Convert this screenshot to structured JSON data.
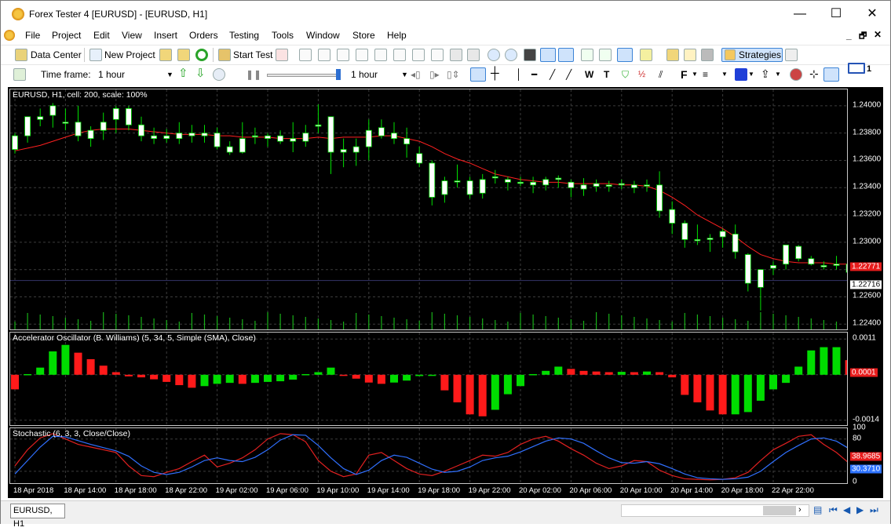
{
  "window": {
    "title": "Forex Tester 4  [EURUSD] - [EURUSD, H1]",
    "minimize": "—",
    "maximize": "☐",
    "close": "✕"
  },
  "menu": [
    "File",
    "Project",
    "Edit",
    "View",
    "Insert",
    "Orders",
    "Testing",
    "Tools",
    "Window",
    "Store",
    "Help"
  ],
  "mdi": {
    "min": "_",
    "restore": "🗗",
    "close": "✕"
  },
  "toolbar1": {
    "data_center": "Data Center",
    "new_project": "New Project",
    "start_test": "Start Test",
    "strategies": "Strategies"
  },
  "toolbar2": {
    "timeframe_label": "Time frame:",
    "timeframe_value": "1 hour",
    "speed_tf_value": "1 hour",
    "font_btn": "F",
    "mail_count": "1"
  },
  "chart": {
    "main_label": "EURUSD, H1, cell: 200, scale: 100%",
    "ac_label": "Accelerator Oscillator (B. Williams) (5, 34, 5, Simple (SMA), Close)",
    "stoch_label": "Stochastic (6, 3, 3, Close/Close)",
    "main_ticks": [
      "1.24000",
      "1.23800",
      "1.23600",
      "1.23400",
      "1.23200",
      "1.23000",
      "1.22600",
      "1.22400"
    ],
    "main_tags": {
      "ma": "1.22771",
      "price": "1.22716"
    },
    "ac_ticks": [
      "0.0011",
      "-0.0014"
    ],
    "ac_tag": "0.0001",
    "stoch_ticks": [
      "100",
      "80",
      "0"
    ],
    "stoch_tags": {
      "main": "38.9685",
      "signal": "30.3710"
    },
    "x_ticks": [
      "18 Apr 2018",
      "18 Apr 14:00",
      "18 Apr 18:00",
      "18 Apr 22:00",
      "19 Apr 02:00",
      "19 Apr 06:00",
      "19 Apr 10:00",
      "19 Apr 14:00",
      "19 Apr 18:00",
      "19 Apr 22:00",
      "20 Apr 02:00",
      "20 Apr 06:00",
      "20 Apr 10:00",
      "20 Apr 14:00",
      "20 Apr 18:00",
      "22 Apr 22:00"
    ]
  },
  "colors": {
    "bull": "#ffffff",
    "bear": "#ffffff",
    "wick": "#00e000",
    "ma": "#ff2020",
    "ac_up": "#00dd00",
    "ac_down": "#ff1a1a",
    "stoch_main": "#e02020",
    "stoch_signal": "#3070ff",
    "price_line": "#34346a",
    "grid": "#3c3c3c"
  },
  "chart_data": [
    {
      "type": "candlestick",
      "title": "EURUSD, H1, cell: 200, scale: 100%",
      "ylim": [
        1.2235,
        1.2412
      ],
      "candles": [
        [
          1.2368,
          1.238,
          1.2365,
          1.2378
        ],
        [
          1.2378,
          1.2392,
          1.2373,
          1.2392
        ],
        [
          1.239,
          1.2398,
          1.2385,
          1.2392
        ],
        [
          1.2393,
          1.2402,
          1.2384,
          1.24
        ],
        [
          1.2388,
          1.2398,
          1.2382,
          1.2388
        ],
        [
          1.2388,
          1.24,
          1.2374,
          1.2378
        ],
        [
          1.2376,
          1.2385,
          1.237,
          1.2382
        ],
        [
          1.2382,
          1.2395,
          1.2375,
          1.2388
        ],
        [
          1.239,
          1.24,
          1.238,
          1.2398
        ],
        [
          1.2398,
          1.24,
          1.2382,
          1.2386
        ],
        [
          1.2386,
          1.2392,
          1.2374,
          1.2378
        ],
        [
          1.2378,
          1.2384,
          1.2372,
          1.2376
        ],
        [
          1.2376,
          1.2383,
          1.2373,
          1.2378
        ],
        [
          1.238,
          1.2388,
          1.2372,
          1.2376
        ],
        [
          1.2378,
          1.2386,
          1.2373,
          1.238
        ],
        [
          1.238,
          1.2386,
          1.2373,
          1.2378
        ],
        [
          1.238,
          1.2384,
          1.2368,
          1.237
        ],
        [
          1.237,
          1.2374,
          1.2364,
          1.2366
        ],
        [
          1.2366,
          1.2388,
          1.2365,
          1.2376
        ],
        [
          1.2378,
          1.2384,
          1.2372,
          1.2378
        ],
        [
          1.2378,
          1.238,
          1.237,
          1.2376
        ],
        [
          1.2378,
          1.2382,
          1.2372,
          1.2374
        ],
        [
          1.2374,
          1.2388,
          1.2366,
          1.2376
        ],
        [
          1.2374,
          1.2386,
          1.237,
          1.238
        ],
        [
          1.2385,
          1.2401,
          1.238,
          1.2386
        ],
        [
          1.2392,
          1.2392,
          1.235,
          1.2366
        ],
        [
          1.2366,
          1.2376,
          1.2355,
          1.2368
        ],
        [
          1.2366,
          1.2376,
          1.2356,
          1.237
        ],
        [
          1.237,
          1.239,
          1.236,
          1.2382
        ],
        [
          1.2384,
          1.239,
          1.2376,
          1.2378
        ],
        [
          1.238,
          1.2388,
          1.2372,
          1.2376
        ],
        [
          1.2376,
          1.2384,
          1.2362,
          1.2372
        ],
        [
          1.2365,
          1.237,
          1.2355,
          1.2358
        ],
        [
          1.2358,
          1.236,
          1.2327,
          1.2333
        ],
        [
          1.2335,
          1.2348,
          1.2329,
          1.2345
        ],
        [
          1.2345,
          1.2357,
          1.234,
          1.2345
        ],
        [
          1.2335,
          1.2348,
          1.2332,
          1.2345
        ],
        [
          1.2346,
          1.235,
          1.2332,
          1.2336
        ],
        [
          1.2348,
          1.2353,
          1.2343,
          1.2348
        ],
        [
          1.2344,
          1.2348,
          1.2338,
          1.2346
        ],
        [
          1.2344,
          1.2348,
          1.2341,
          1.2344
        ],
        [
          1.2342,
          1.2348,
          1.2336,
          1.2344
        ],
        [
          1.2346,
          1.2348,
          1.2338,
          1.2342
        ],
        [
          1.2347,
          1.2349,
          1.234,
          1.2346
        ],
        [
          1.2344,
          1.2346,
          1.2333,
          1.234
        ],
        [
          1.2339,
          1.2347,
          1.2334,
          1.2342
        ],
        [
          1.2341,
          1.2346,
          1.2337,
          1.2343
        ],
        [
          1.2341,
          1.2345,
          1.2337,
          1.2342
        ],
        [
          1.2342,
          1.2346,
          1.2339,
          1.2343
        ],
        [
          1.2342,
          1.2345,
          1.2336,
          1.234
        ],
        [
          1.2342,
          1.2346,
          1.2337,
          1.2342
        ],
        [
          1.2342,
          1.2352,
          1.2318,
          1.2323
        ],
        [
          1.2324,
          1.233,
          1.2306,
          1.2314
        ],
        [
          1.2314,
          1.2316,
          1.2296,
          1.2302
        ],
        [
          1.2302,
          1.2313,
          1.2298,
          1.2302
        ],
        [
          1.2302,
          1.2306,
          1.2293,
          1.2303
        ],
        [
          1.2304,
          1.231,
          1.2296,
          1.2308
        ],
        [
          1.2306,
          1.2313,
          1.2288,
          1.2293
        ],
        [
          1.2291,
          1.2292,
          1.2264,
          1.227
        ],
        [
          1.2267,
          1.228,
          1.225,
          1.228
        ],
        [
          1.2281,
          1.2286,
          1.2276,
          1.2283
        ],
        [
          1.2284,
          1.2298,
          1.228,
          1.2298
        ],
        [
          1.2297,
          1.2298,
          1.2286,
          1.2288
        ],
        [
          1.2288,
          1.229,
          1.2283,
          1.2284
        ],
        [
          1.2283,
          1.2286,
          1.228,
          1.2282
        ],
        [
          1.2283,
          1.229,
          1.228,
          1.2284
        ],
        [
          1.2284,
          1.2288,
          1.2275,
          1.2278
        ],
        [
          1.227,
          1.2285,
          1.227,
          1.2284
        ],
        [
          1.2284,
          1.2288,
          1.2277,
          1.228
        ],
        [
          1.228,
          1.2282,
          1.2272,
          1.2274
        ],
        [
          1.2274,
          1.2278,
          1.2269,
          1.2272
        ],
        [
          1.2268,
          1.228,
          1.2266,
          1.2278
        ],
        [
          1.2277,
          1.228,
          1.227,
          1.2274
        ],
        [
          1.2276,
          1.2278,
          1.227,
          1.2272
        ]
      ],
      "ma": [
        1.2367,
        1.2369,
        1.2371,
        1.2374,
        1.2377,
        1.238,
        1.2382,
        1.2383,
        1.2383,
        1.2383,
        1.2382,
        1.2381,
        1.238,
        1.2379,
        1.2379,
        1.2379,
        1.2378,
        1.2378,
        1.2377,
        1.2377,
        1.2377,
        1.2376,
        1.2376,
        1.2376,
        1.2377,
        1.2376,
        1.2377,
        1.2377,
        1.2377,
        1.2378,
        1.2378,
        1.2376,
        1.2374,
        1.237,
        1.2365,
        1.2361,
        1.2358,
        1.2354,
        1.235,
        1.2348,
        1.2346,
        1.2345,
        1.2344,
        1.2344,
        1.2343,
        1.2343,
        1.2343,
        1.2343,
        1.2342,
        1.2342,
        1.2341,
        1.2338,
        1.2333,
        1.2327,
        1.232,
        1.2315,
        1.231,
        1.2304,
        1.2297,
        1.2291,
        1.2288,
        1.2286,
        1.2285,
        1.2285,
        1.2285,
        1.2284,
        1.2284,
        1.2284,
        1.2283,
        1.2282,
        1.2281,
        1.228,
        1.2279,
        1.2278
      ]
    },
    {
      "type": "bar",
      "title": "Accelerator Oscillator (B. Williams) (5, 34, 5, Simple (SMA), Close)",
      "ylim": [
        -0.0016,
        0.0013
      ],
      "values": [
        -0.00045,
        2e-05,
        0.00022,
        0.00072,
        0.00092,
        0.00068,
        0.00048,
        0.00028,
        8e-05,
        -5e-05,
        -8e-05,
        -0.00014,
        -0.00022,
        -0.00032,
        -0.0004,
        -0.00035,
        -0.00028,
        -0.00025,
        -0.00028,
        -0.00025,
        -0.00022,
        -0.0002,
        -0.00015,
        2e-05,
        8e-05,
        0.00022,
        -1e-05,
        -0.00012,
        -0.00024,
        -0.00028,
        -0.00024,
        -0.00018,
        -4e-05,
        -1e-05,
        -0.00048,
        -0.00085,
        -0.00122,
        -0.00128,
        -0.00108,
        -0.0006,
        -0.00035,
        2e-05,
        0.00012,
        0.00025,
        0.00018,
        0.00012,
        0.0001,
        8e-05,
        9e-05,
        8e-05,
        0.0001,
        8e-05,
        -8e-05,
        -0.00062,
        -0.00085,
        -0.0011,
        -0.00122,
        -0.00122,
        -0.00115,
        -0.0008,
        -0.00045,
        -0.00025,
        0.00025,
        0.00075,
        0.00085,
        0.00085,
        0.00045,
        0.00025,
        0.00022,
        0.00015,
        0.00012,
        0.00012,
        0.0001,
        4e-05
      ]
    },
    {
      "type": "line",
      "title": "Stochastic (6, 3, 3, Close/Close)",
      "ylim": [
        -5,
        100
      ],
      "series": [
        {
          "values": [
            30,
            60,
            82,
            90,
            80,
            70,
            65,
            60,
            55,
            30,
            12,
            10,
            18,
            25,
            38,
            50,
            28,
            35,
            45,
            60,
            80,
            90,
            88,
            75,
            40,
            20,
            10,
            15,
            50,
            55,
            40,
            25,
            15,
            12,
            20,
            30,
            40,
            50,
            48,
            55,
            70,
            80,
            85,
            76,
            62,
            50,
            35,
            25,
            30,
            40,
            38,
            22,
            12,
            6,
            5,
            4,
            5,
            8,
            18,
            40,
            60,
            72,
            85,
            88,
            70,
            55,
            35,
            20,
            10,
            8,
            12,
            28,
            35,
            39
          ]
        },
        {
          "values": [
            15,
            40,
            65,
            85,
            84,
            77,
            70,
            64,
            58,
            48,
            30,
            18,
            14,
            18,
            28,
            40,
            45,
            40,
            38,
            46,
            60,
            78,
            88,
            87,
            68,
            45,
            25,
            14,
            22,
            40,
            50,
            46,
            35,
            24,
            18,
            20,
            28,
            40,
            45,
            48,
            56,
            66,
            76,
            82,
            80,
            72,
            58,
            45,
            36,
            35,
            38,
            34,
            25,
            15,
            8,
            6,
            5,
            6,
            9,
            20,
            38,
            55,
            68,
            80,
            82,
            76,
            62,
            44,
            28,
            16,
            11,
            16,
            24,
            30
          ]
        }
      ]
    }
  ]
}
